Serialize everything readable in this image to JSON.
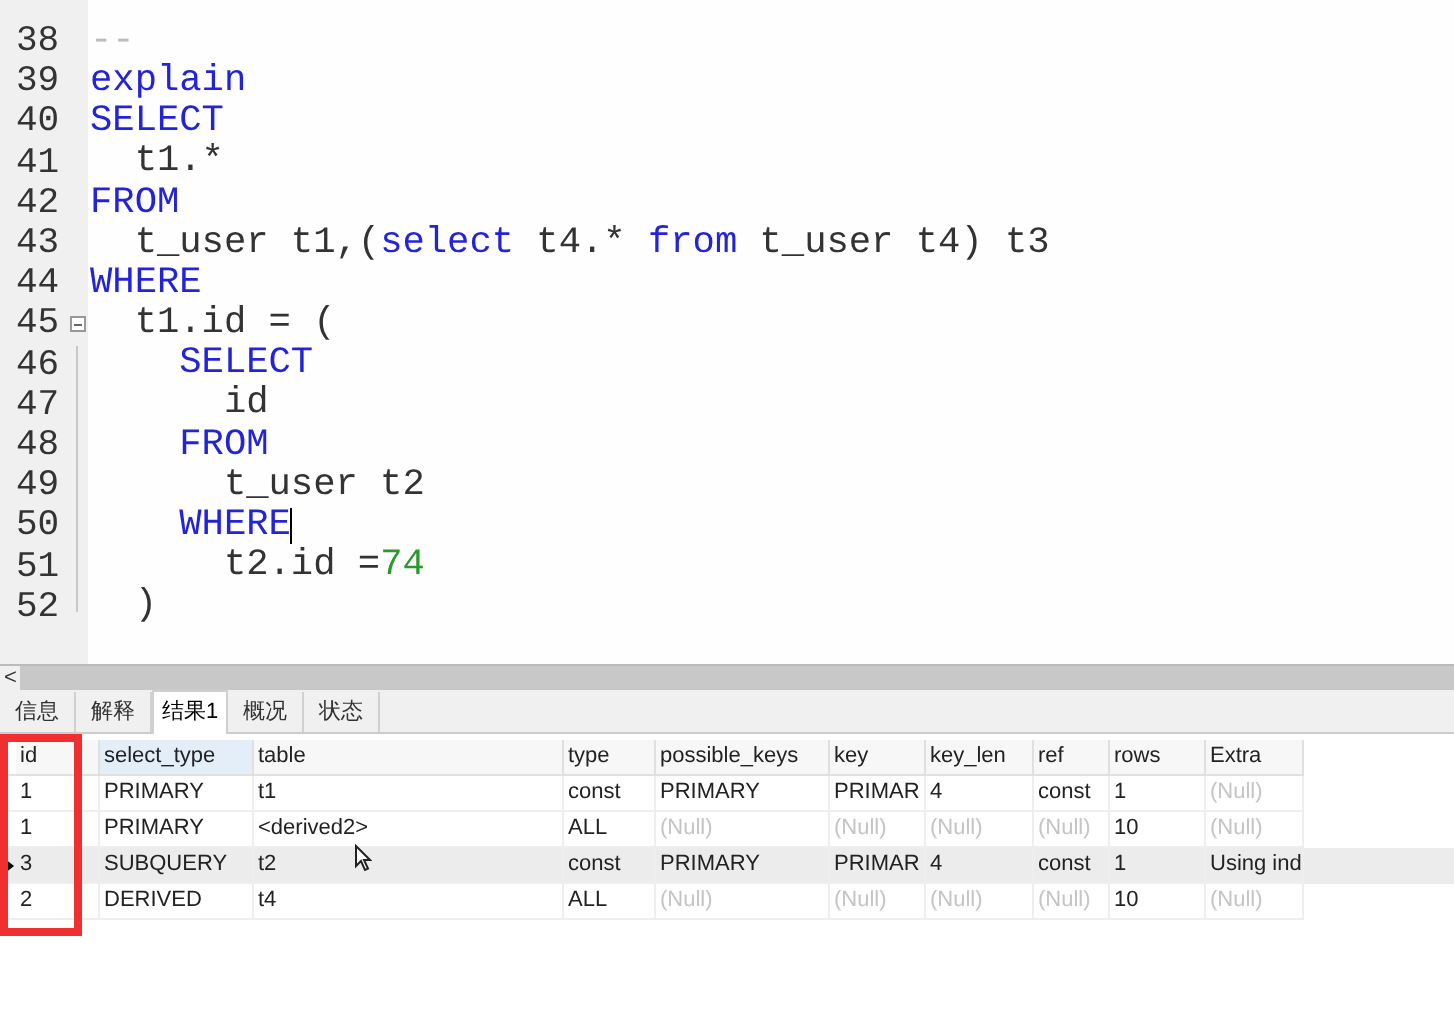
{
  "editor": {
    "lines": [
      {
        "number": "38",
        "tokens": [
          {
            "kind": "comment",
            "text": "--"
          }
        ]
      },
      {
        "number": "39",
        "tokens": [
          {
            "kind": "keyword",
            "text": "explain"
          }
        ]
      },
      {
        "number": "40",
        "tokens": [
          {
            "kind": "keyword",
            "text": "SELECT"
          }
        ]
      },
      {
        "number": "41",
        "tokens": [
          {
            "kind": "plain",
            "text": "  t1.*"
          }
        ]
      },
      {
        "number": "42",
        "tokens": [
          {
            "kind": "keyword",
            "text": "FROM"
          }
        ]
      },
      {
        "number": "43",
        "tokens": [
          {
            "kind": "plain",
            "text": "  t_user t1,("
          },
          {
            "kind": "keyword",
            "text": "select"
          },
          {
            "kind": "plain",
            "text": " t4.* "
          },
          {
            "kind": "keyword",
            "text": "from"
          },
          {
            "kind": "plain",
            "text": " t_user t4) t3"
          }
        ]
      },
      {
        "number": "44",
        "tokens": [
          {
            "kind": "keyword",
            "text": "WHERE"
          }
        ]
      },
      {
        "number": "45",
        "fold_start": true,
        "tokens": [
          {
            "kind": "plain",
            "text": "  t1.id = ("
          }
        ]
      },
      {
        "number": "46",
        "in_fold": true,
        "tokens": [
          {
            "kind": "keyword",
            "text": "    SELECT"
          }
        ]
      },
      {
        "number": "47",
        "in_fold": true,
        "tokens": [
          {
            "kind": "plain",
            "text": "      id"
          }
        ]
      },
      {
        "number": "48",
        "in_fold": true,
        "tokens": [
          {
            "kind": "keyword",
            "text": "    FROM"
          }
        ]
      },
      {
        "number": "49",
        "in_fold": true,
        "tokens": [
          {
            "kind": "plain",
            "text": "      t_user t2"
          }
        ]
      },
      {
        "number": "50",
        "in_fold": true,
        "caret": true,
        "tokens": [
          {
            "kind": "keyword",
            "text": "    WHERE"
          }
        ]
      },
      {
        "number": "51",
        "in_fold": true,
        "tokens": [
          {
            "kind": "plain",
            "text": "      t2.id ="
          },
          {
            "kind": "number",
            "text": "74"
          }
        ]
      },
      {
        "number": "52",
        "fold_end": true,
        "tokens": [
          {
            "kind": "plain",
            "text": "  )"
          }
        ]
      }
    ]
  },
  "scrollbar": {
    "arrow": "<"
  },
  "tabs": [
    {
      "label": "信息",
      "selected": false
    },
    {
      "label": "解释",
      "selected": false
    },
    {
      "label": "结果1",
      "selected": true
    },
    {
      "label": "概况",
      "selected": false
    },
    {
      "label": "状态",
      "selected": false
    }
  ],
  "table": {
    "columns": [
      {
        "label": "id",
        "highlighted": false
      },
      {
        "label": "select_type",
        "highlighted": true
      },
      {
        "label": "table",
        "highlighted": false
      },
      {
        "label": "type",
        "highlighted": false
      },
      {
        "label": "possible_keys",
        "highlighted": false
      },
      {
        "label": "key",
        "highlighted": false
      },
      {
        "label": "key_len",
        "highlighted": false
      },
      {
        "label": "ref",
        "highlighted": false
      },
      {
        "label": "rows",
        "highlighted": false
      },
      {
        "label": "Extra",
        "highlighted": false
      }
    ],
    "rows": [
      {
        "selected": false,
        "cells": [
          {
            "text": "1",
            "null": false
          },
          {
            "text": "PRIMARY",
            "null": false
          },
          {
            "text": "t1",
            "null": false
          },
          {
            "text": "const",
            "null": false
          },
          {
            "text": "PRIMARY",
            "null": false
          },
          {
            "text": "PRIMAR",
            "null": false
          },
          {
            "text": "4",
            "null": false
          },
          {
            "text": "const",
            "null": false
          },
          {
            "text": "1",
            "null": false
          },
          {
            "text": "(Null)",
            "null": true
          }
        ]
      },
      {
        "selected": false,
        "cells": [
          {
            "text": "1",
            "null": false
          },
          {
            "text": "PRIMARY",
            "null": false
          },
          {
            "text": "<derived2>",
            "null": false
          },
          {
            "text": "ALL",
            "null": false
          },
          {
            "text": "(Null)",
            "null": true
          },
          {
            "text": "(Null)",
            "null": true
          },
          {
            "text": "(Null)",
            "null": true
          },
          {
            "text": "(Null)",
            "null": true
          },
          {
            "text": "10",
            "null": false
          },
          {
            "text": "(Null)",
            "null": true
          }
        ]
      },
      {
        "selected": true,
        "cells": [
          {
            "text": "3",
            "null": false
          },
          {
            "text": "SUBQUERY",
            "null": false
          },
          {
            "text": "t2",
            "null": false
          },
          {
            "text": "const",
            "null": false
          },
          {
            "text": "PRIMARY",
            "null": false
          },
          {
            "text": "PRIMAR",
            "null": false
          },
          {
            "text": "4",
            "null": false
          },
          {
            "text": "const",
            "null": false
          },
          {
            "text": "1",
            "null": false
          },
          {
            "text": "Using ind",
            "null": false
          }
        ]
      },
      {
        "selected": false,
        "cells": [
          {
            "text": "2",
            "null": false
          },
          {
            "text": "DERIVED",
            "null": false
          },
          {
            "text": "t4",
            "null": false
          },
          {
            "text": "ALL",
            "null": false
          },
          {
            "text": "(Null)",
            "null": true
          },
          {
            "text": "(Null)",
            "null": true
          },
          {
            "text": "(Null)",
            "null": true
          },
          {
            "text": "(Null)",
            "null": true
          },
          {
            "text": "10",
            "null": false
          },
          {
            "text": "(Null)",
            "null": true
          }
        ]
      }
    ]
  },
  "annotations": [
    {
      "kind": "highlight-box",
      "color": "#f03030"
    }
  ]
}
